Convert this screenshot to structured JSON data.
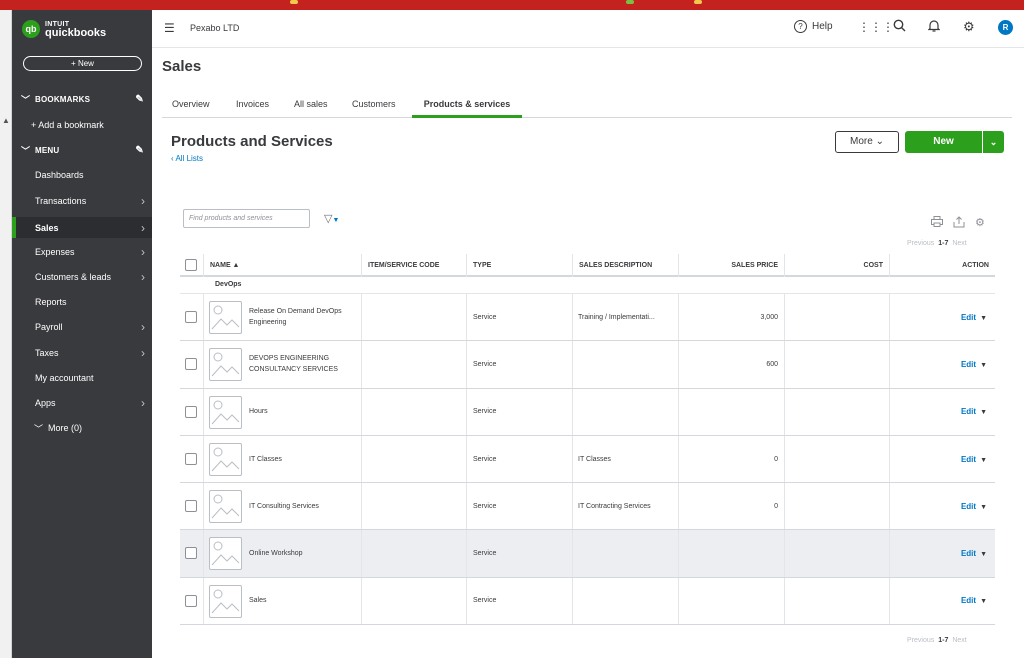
{
  "sidebar": {
    "logo_top": "intuit",
    "logo_bottom": "quickbooks",
    "new_label": "+ New",
    "bookmarks_label": "BOOKMARKS",
    "add_bookmark_label": "+  Add a bookmark",
    "menu_label": "MENU",
    "items": [
      {
        "label": "Dashboards"
      },
      {
        "label": "Transactions"
      },
      {
        "label": "Sales"
      },
      {
        "label": "Expenses"
      },
      {
        "label": "Customers & leads"
      },
      {
        "label": "Reports"
      },
      {
        "label": "Payroll"
      },
      {
        "label": "Taxes"
      },
      {
        "label": "My accountant"
      },
      {
        "label": "Apps"
      }
    ],
    "more_label": "More (0)"
  },
  "header": {
    "company": "Pexabo LTD",
    "help_label": "Help",
    "avatar_letter": "R"
  },
  "page": {
    "title": "Sales",
    "tabs": [
      {
        "label": "Overview"
      },
      {
        "label": "Invoices"
      },
      {
        "label": "All sales"
      },
      {
        "label": "Customers"
      },
      {
        "label": "Products & services"
      }
    ],
    "section_title": "Products and Services",
    "all_lists": "All Lists",
    "more_button": "More",
    "new_button": "New",
    "search_placeholder": "Find products and services"
  },
  "pager": {
    "previous": "Previous",
    "range": "1-7",
    "next": "Next"
  },
  "table": {
    "columns": {
      "name": "NAME ▲",
      "code": "ITEM/SERVICE CODE",
      "type": "TYPE",
      "desc": "SALES DESCRIPTION",
      "price": "SALES PRICE",
      "cost": "COST",
      "action": "ACTION"
    },
    "group_label": "DevOps",
    "edit_label": "Edit",
    "rows": [
      {
        "name": "Release On Demand DevOps Engineering",
        "type": "Service",
        "desc": "Training / Implementati...",
        "price": "3,000"
      },
      {
        "name": "DEVOPS ENGINEERING CONSULTANCY SERVICES",
        "type": "Service",
        "desc": "",
        "price": "600"
      },
      {
        "name": "Hours",
        "type": "Service",
        "desc": "",
        "price": ""
      },
      {
        "name": "IT Classes",
        "type": "Service",
        "desc": "IT Classes",
        "price": "0"
      },
      {
        "name": "IT Consulting Services",
        "type": "Service",
        "desc": "IT Contracting Services",
        "price": "0"
      },
      {
        "name": "Online Workshop",
        "type": "Service",
        "desc": "",
        "price": ""
      },
      {
        "name": "Sales",
        "type": "Service",
        "desc": "",
        "price": ""
      }
    ]
  },
  "colors": {
    "brand_green": "#2ca01c",
    "sidebar_bg": "#393a3d",
    "link_blue": "#0077c5",
    "browser_red": "#c3221e"
  }
}
